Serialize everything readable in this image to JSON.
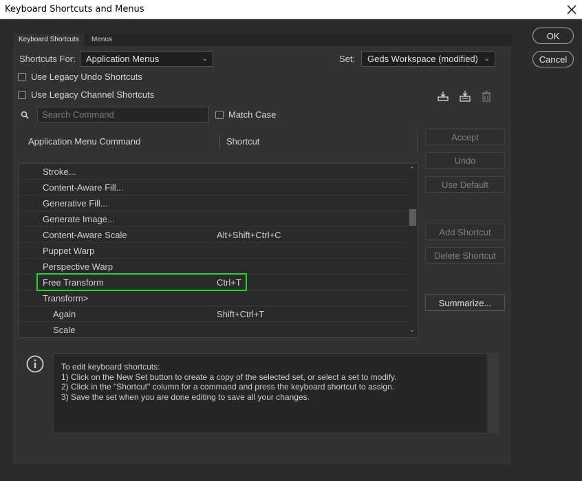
{
  "window": {
    "title": "Keyboard Shortcuts and Menus"
  },
  "tabs": [
    "Keyboard Shortcuts",
    "Menus"
  ],
  "shortcuts_for": {
    "label": "Shortcuts For:",
    "value": "Application Menus"
  },
  "set": {
    "label": "Set:",
    "value": "Geds Workspace (modified)"
  },
  "checkboxes": {
    "legacy_undo": "Use Legacy Undo Shortcuts",
    "legacy_channel": "Use Legacy Channel Shortcuts",
    "match_case": "Match Case"
  },
  "search": {
    "placeholder": "Search Command"
  },
  "columns": {
    "command": "Application Menu Command",
    "shortcut": "Shortcut"
  },
  "rows": [
    {
      "command": "Stroke...",
      "shortcut": "",
      "indent": 0
    },
    {
      "command": "Content-Aware Fill...",
      "shortcut": "",
      "indent": 0
    },
    {
      "command": "Generative Fill...",
      "shortcut": "",
      "indent": 0
    },
    {
      "command": "Generate Image...",
      "shortcut": "",
      "indent": 0
    },
    {
      "command": "Content-Aware Scale",
      "shortcut": "Alt+Shift+Ctrl+C",
      "indent": 0
    },
    {
      "command": "Puppet Warp",
      "shortcut": "",
      "indent": 0
    },
    {
      "command": "Perspective Warp",
      "shortcut": "",
      "indent": 0
    },
    {
      "command": "Free Transform",
      "shortcut": "Ctrl+T",
      "indent": 0,
      "highlighted": true
    },
    {
      "command": "Transform>",
      "shortcut": "",
      "indent": 0
    },
    {
      "command": "Again",
      "shortcut": "Shift+Ctrl+T",
      "indent": 1
    },
    {
      "command": "Scale",
      "shortcut": "",
      "indent": 1
    }
  ],
  "side_buttons": {
    "accept": "Accept",
    "undo": "Undo",
    "use_default": "Use Default",
    "add_shortcut": "Add Shortcut",
    "delete_shortcut": "Delete Shortcut",
    "summarize": "Summarize..."
  },
  "dialog_buttons": {
    "ok": "OK",
    "cancel": "Cancel"
  },
  "info": {
    "lines": [
      "To edit keyboard shortcuts:",
      "1) Click on the New Set button to create a copy of the selected set, or select a set to modify.",
      "2) Click in the \"Shortcut\" column for a command and press the keyboard shortcut to assign.",
      "3) Save the set when you are done editing to save all your changes."
    ]
  },
  "colors": {
    "highlight": "#22d62a",
    "background": "#323232"
  }
}
